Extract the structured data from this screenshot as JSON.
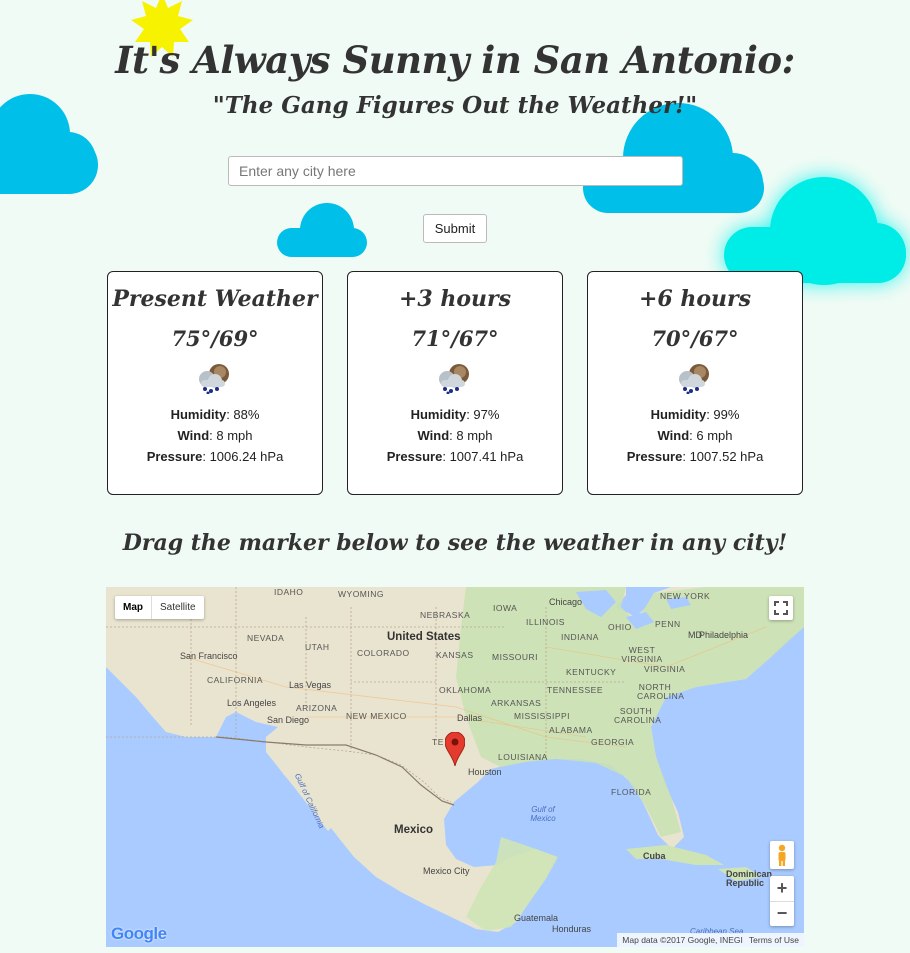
{
  "header": {
    "title": "It's Always Sunny in San Antonio:",
    "subtitle": "\"The Gang Figures Out the Weather!\""
  },
  "search": {
    "placeholder": "Enter any city here",
    "submit_label": "Submit"
  },
  "forecast": [
    {
      "title": "Present Weather",
      "temps": "75°/69°",
      "humidity_label": "Humidity",
      "humidity": ": 88%",
      "wind_label": "Wind",
      "wind": ": 8 mph",
      "pressure_label": "Pressure",
      "pressure": ": 1006.24 hPa"
    },
    {
      "title": "+3 hours",
      "temps": "71°/67°",
      "humidity_label": "Humidity",
      "humidity": ": 97%",
      "wind_label": "Wind",
      "wind": ": 8 mph",
      "pressure_label": "Pressure",
      "pressure": ": 1007.41 hPa"
    },
    {
      "title": "+6 hours",
      "temps": "70°/67°",
      "humidity_label": "Humidity",
      "humidity": ": 99%",
      "wind_label": "Wind",
      "wind": ": 6 mph",
      "pressure_label": "Pressure",
      "pressure": ": 1007.52 hPa"
    }
  ],
  "map_section": {
    "hint": "Drag the marker below to see the weather in any city!",
    "type_map": "Map",
    "type_satellite": "Satellite",
    "attribution": "Map data ©2017 Google, INEGI",
    "terms": "Terms of Use",
    "logo": "Google",
    "zoom_in": "+",
    "zoom_out": "−",
    "labels": {
      "idaho": "IDAHO",
      "wyoming": "WYOMING",
      "nebraska": "NEBRASKA",
      "iowa": "IOWA",
      "chicago": "Chicago",
      "new_york": "NEW YORK",
      "illinois": "ILLINOIS",
      "ohio": "OHIO",
      "penn": "PENN",
      "nevada": "NEVADA",
      "utah": "UTAH",
      "united_states": "United States",
      "colorado": "COLORADO",
      "kansas": "KANSAS",
      "missouri": "MISSOURI",
      "indiana": "INDIANA",
      "philadelphia": "Philadelphia",
      "md": "MD",
      "west_virginia": "WEST VIRGINIA",
      "virginia": "VIRGINIA",
      "san_francisco": "San Francisco",
      "kentucky": "KENTUCKY",
      "california": "CALIFORNIA",
      "las_vegas": "Las Vegas",
      "oklahoma": "OKLAHOMA",
      "tennessee": "TENNESSEE",
      "north_carolina": "NORTH CAROLINA",
      "los_angeles": "Los Angeles",
      "arizona": "ARIZONA",
      "arkansas": "ARKANSAS",
      "san_diego": "San Diego",
      "new_mexico": "NEW MEXICO",
      "dallas": "Dallas",
      "mississippi": "MISSISSIPPI",
      "south_carolina": "SOUTH CAROLINA",
      "alabama": "ALABAMA",
      "georgia": "GEORGIA",
      "texas_partial": "TE",
      "louisiana": "LOUISIANA",
      "houston": "Houston",
      "florida": "FLORIDA",
      "gulf_of_california": "Gulf of California",
      "gulf_of_mexico": "Gulf of Mexico",
      "mexico": "Mexico",
      "cuba": "Cuba",
      "dominican_republic": "Dominican Republic",
      "mexico_city": "Mexico City",
      "guatemala": "Guatemala",
      "honduras": "Honduras",
      "caribbean_sea": "Caribbean Sea"
    }
  },
  "colors": {
    "background": "#f1fbf5",
    "cloud": "#00bfe8",
    "cloud_glow": "#00ece6",
    "sun": "#f6f200",
    "marker": "#e53b2e"
  }
}
